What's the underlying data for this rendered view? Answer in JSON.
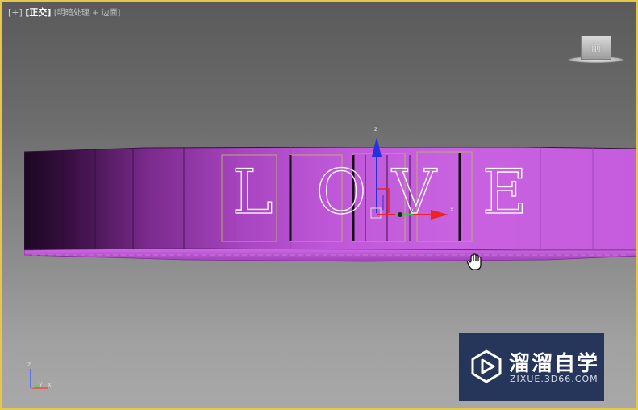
{
  "viewport": {
    "label_plus": "[+]",
    "label_view": "[正交]",
    "label_mode": "[明暗处理 + 边面]",
    "border_color": "#e3c84a"
  },
  "viewcube": {
    "face_label": "前"
  },
  "ring": {
    "letters": [
      "L",
      "O",
      "V",
      "E"
    ],
    "color": "#c05ee0"
  },
  "gizmo": {
    "axis_z": "z",
    "axis_y": "y",
    "axis_x": "x",
    "z_color": "#2233dd",
    "x_color": "#ee2222",
    "y_color": "#33cc33"
  },
  "tripod": {
    "axis_z": "z",
    "axis_y": "y",
    "axis_x": "x"
  },
  "cursor": {
    "icon": "hand-pan-icon"
  },
  "watermark": {
    "name": "溜溜自学",
    "url": "ZIXUE.3D66.COM",
    "bg_color": "#26365a"
  }
}
